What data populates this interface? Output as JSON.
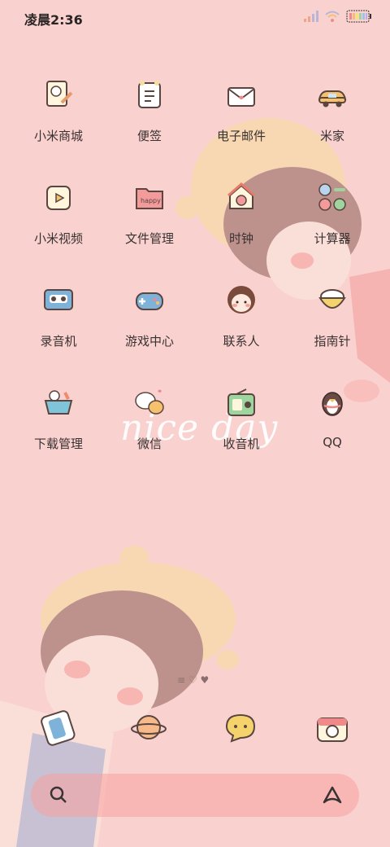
{
  "status_bar": {
    "time": "凌晨2:36"
  },
  "wallpaper_text": "nice day",
  "apps": [
    {
      "label": "小米商城",
      "icon": "note-cat-icon"
    },
    {
      "label": "便签",
      "icon": "memo-icon"
    },
    {
      "label": "电子邮件",
      "icon": "envelope-icon"
    },
    {
      "label": "米家",
      "icon": "car-icon"
    },
    {
      "label": "小米视频",
      "icon": "video-icon"
    },
    {
      "label": "文件管理",
      "icon": "folder-icon"
    },
    {
      "label": "时钟",
      "icon": "house-clock-icon"
    },
    {
      "label": "计算器",
      "icon": "calculator-icon"
    },
    {
      "label": "录音机",
      "icon": "cassette-icon"
    },
    {
      "label": "游戏中心",
      "icon": "gamepad-icon"
    },
    {
      "label": "联系人",
      "icon": "girl-face-icon"
    },
    {
      "label": "指南针",
      "icon": "bowl-icon"
    },
    {
      "label": "下载管理",
      "icon": "basket-icon"
    },
    {
      "label": "微信",
      "icon": "chat-bears-icon"
    },
    {
      "label": "收音机",
      "icon": "radio-icon"
    },
    {
      "label": "QQ",
      "icon": "penguin-icon"
    }
  ],
  "dock": [
    {
      "icon": "phone-icon"
    },
    {
      "icon": "planet-icon"
    },
    {
      "icon": "speech-bubble-icon"
    },
    {
      "icon": "camera-icon"
    }
  ],
  "colors": {
    "wallpaper": "#f9d2cf",
    "search_bar": "#f7a0a0"
  }
}
